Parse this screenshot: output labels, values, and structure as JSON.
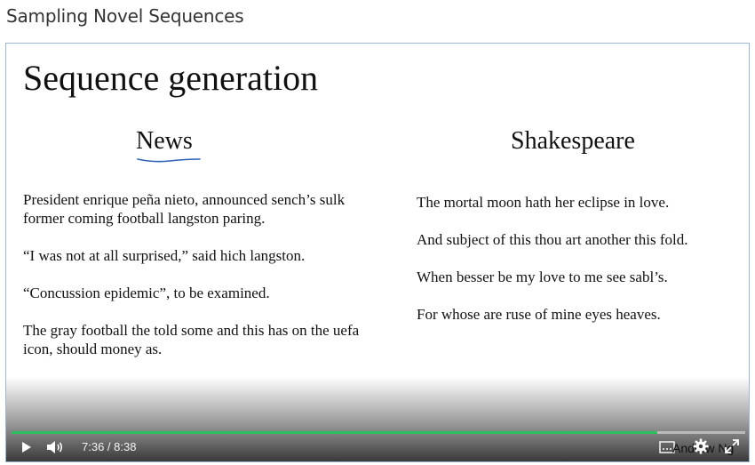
{
  "page": {
    "title": "Sampling Novel Sequences"
  },
  "slide": {
    "title": "Sequence generation",
    "news": {
      "heading": "News",
      "paragraphs": [
        "President enrique peña nieto, announced sench’s sulk former coming football langston paring.",
        "“I was not at all surprised,” said hich langston.",
        "“Concussion epidemic”, to be examined.",
        "The gray football the told some and this has on the uefa icon, should money as."
      ]
    },
    "shakespeare": {
      "heading": "Shakespeare",
      "lines": [
        "The mortal moon hath her eclipse in love.",
        "And subject of this thou art another this fold.",
        "When besser be my love to me see sabl’s.",
        "For whose are ruse of mine eyes heaves."
      ]
    },
    "underline_color": "#2a62b8"
  },
  "player": {
    "current_time": "7:36",
    "separator": " / ",
    "duration": "8:38",
    "progress_fraction": 0.88,
    "progress_color": "#2dbe60",
    "watermark": "Andrew Ng",
    "icons": {
      "play": "play-icon",
      "volume": "volume-icon",
      "captions": "captions-icon",
      "settings": "gear-icon",
      "fullscreen": "fullscreen-icon"
    }
  }
}
